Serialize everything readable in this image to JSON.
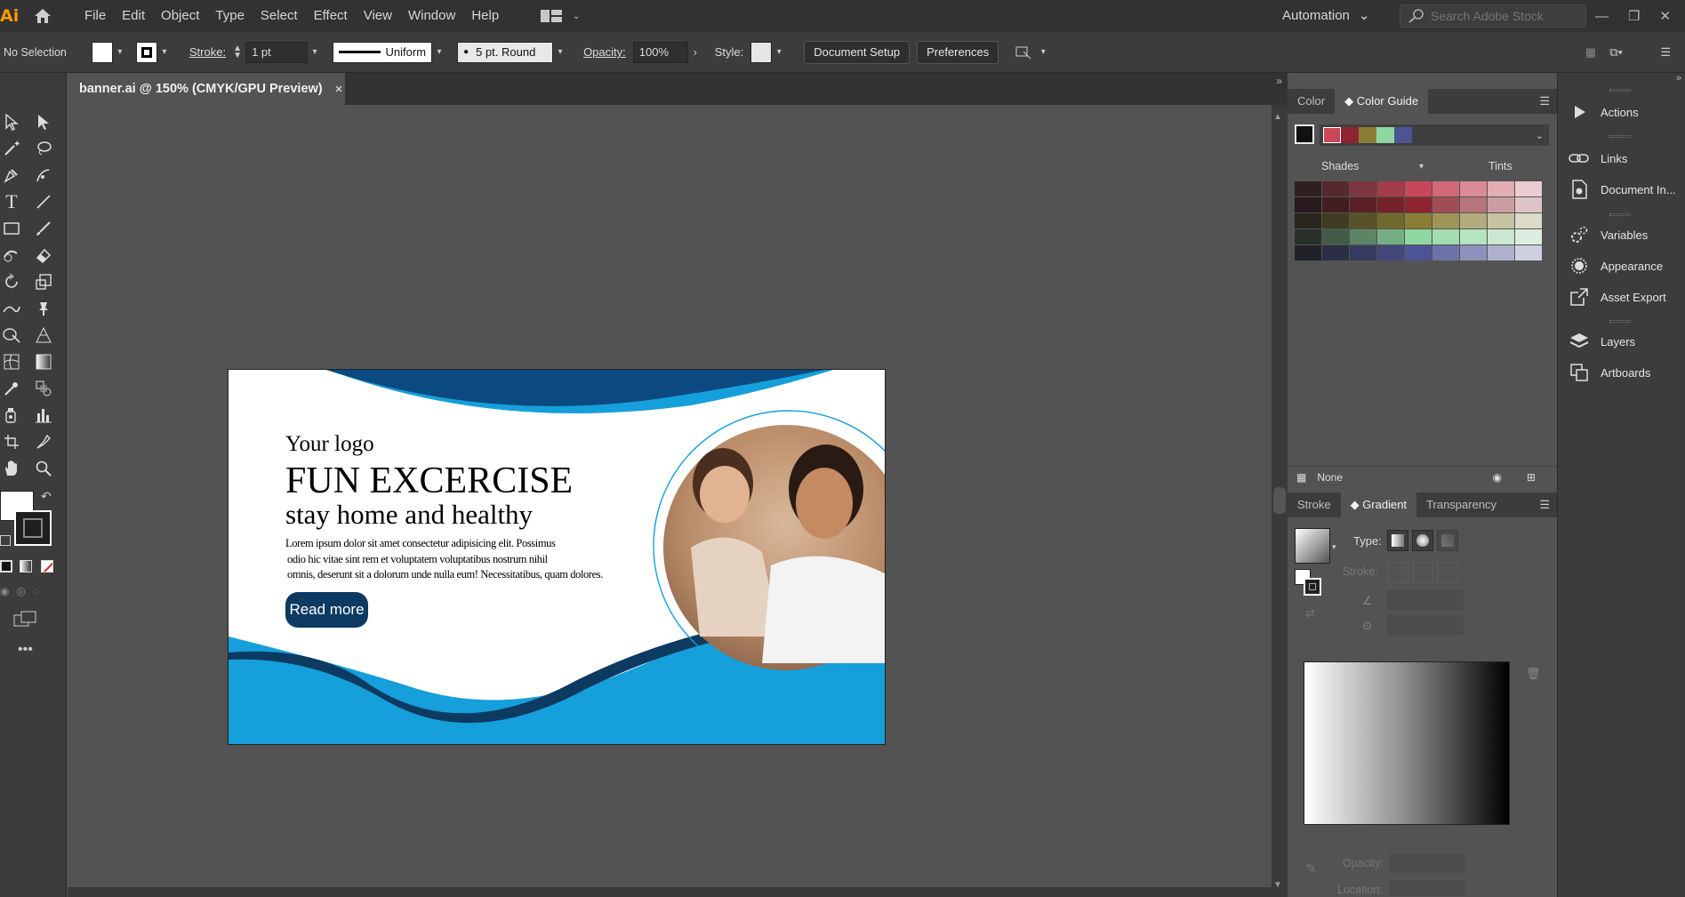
{
  "app": {
    "logo": "Ai"
  },
  "menu": [
    "File",
    "Edit",
    "Object",
    "Type",
    "Select",
    "Effect",
    "View",
    "Window",
    "Help"
  ],
  "automation": "Automation",
  "search": {
    "placeholder": "Search Adobe Stock"
  },
  "control": {
    "selection": "No Selection",
    "stroke_label": "Stroke:",
    "stroke_weight": "1 pt",
    "profile": "Uniform",
    "brush": "5 pt. Round",
    "opacity_label": "Opacity:",
    "opacity": "100%",
    "style_label": "Style:",
    "doc_setup": "Document Setup",
    "preferences": "Preferences"
  },
  "document": {
    "tab_title": "banner.ai @ 150% (CMYK/GPU Preview)",
    "close": "×"
  },
  "banner": {
    "logo_text": "Your logo",
    "headline": "FUN EXCERCISE",
    "subhead": "stay home and healthy",
    "body_line1": "Lorem ipsum dolor sit amet consectetur adipisicing elit. Possimus",
    "body_line2": "odio hic vitae sint rem et voluptatem voluptatibus nostrum nihil",
    "body_line3": "omnis, deserunt sit a dolorum unde nulla eum! Necessitatibus, quam dolores.",
    "button": "Read more",
    "colors": {
      "dark_blue": "#0c3a61",
      "light_blue": "#159fdb",
      "navy": "#0a4a80"
    }
  },
  "color_guide": {
    "tabs": [
      "Color",
      "Color Guide"
    ],
    "active_tab": "Color Guide",
    "harmony": [
      "#c8485a",
      "#8e2430",
      "#8a7e34",
      "#8fd7a0",
      "#4d5495"
    ],
    "shades_label": "Shades",
    "tints_label": "Tints",
    "footer_label": "None"
  },
  "gradient": {
    "tabs": [
      "Stroke",
      "Gradient",
      "Transparency"
    ],
    "active_tab": "Gradient",
    "type_label": "Type:",
    "stroke_label": "Stroke:",
    "opacity_label": "Opacity:",
    "location_label": "Location:"
  },
  "side_panels": [
    {
      "name": "Actions",
      "icon": "play-icon"
    },
    {
      "name": "Links",
      "icon": "link-icon"
    },
    {
      "name": "Document In...",
      "icon": "document-info-icon"
    },
    {
      "name": "Variables",
      "icon": "variables-icon"
    },
    {
      "name": "Appearance",
      "icon": "appearance-icon"
    },
    {
      "name": "Asset Export",
      "icon": "asset-export-icon"
    },
    {
      "name": "Layers",
      "icon": "layers-icon"
    },
    {
      "name": "Artboards",
      "icon": "artboards-icon"
    }
  ]
}
